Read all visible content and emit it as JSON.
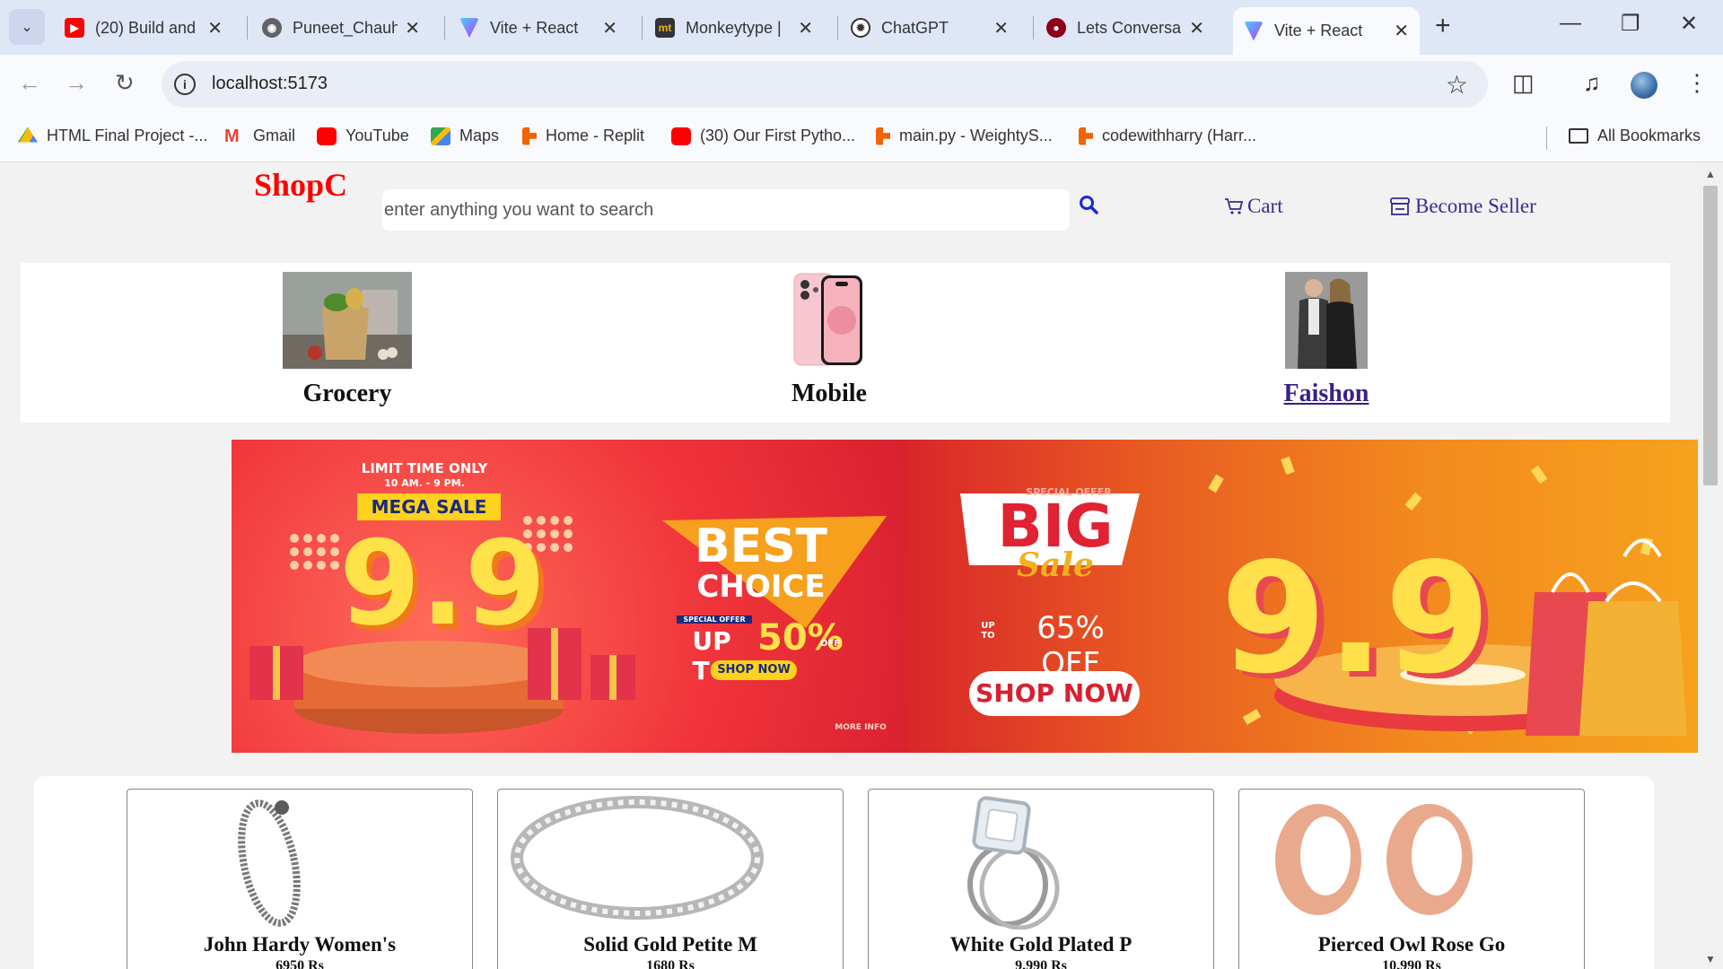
{
  "browser": {
    "tabs": [
      {
        "title": "(20) Build and",
        "icon": "youtube-icon"
      },
      {
        "title": "Puneet_Chauh",
        "icon": "globe-icon"
      },
      {
        "title": "Vite + React",
        "icon": "vite-icon"
      },
      {
        "title": "Monkeytype |",
        "icon": "monkeytype-icon"
      },
      {
        "title": "ChatGPT",
        "icon": "chatgpt-icon"
      },
      {
        "title": "Lets Conversa",
        "icon": "app-icon"
      },
      {
        "title": "Vite + React",
        "icon": "vite-icon",
        "active": true
      }
    ],
    "url": "localhost:5173",
    "bookmarks": [
      {
        "label": "HTML Final Project -...",
        "icon": "drive-icon"
      },
      {
        "label": "Gmail",
        "icon": "gmail-icon"
      },
      {
        "label": "YouTube",
        "icon": "youtube-icon"
      },
      {
        "label": "Maps",
        "icon": "maps-icon"
      },
      {
        "label": "Home - Replit",
        "icon": "replit-icon"
      },
      {
        "label": "(30) Our First Pytho...",
        "icon": "youtube-icon"
      },
      {
        "label": "main.py - WeightyS...",
        "icon": "replit-icon"
      },
      {
        "label": "codewithharry (Harr...",
        "icon": "replit-icon"
      }
    ],
    "all_bookmarks_label": "All Bookmarks"
  },
  "header": {
    "logo": "ShopC",
    "search_placeholder": "enter anything you want to search",
    "cart_label": "Cart",
    "seller_label": "Become Seller"
  },
  "categories": [
    {
      "label": "Grocery"
    },
    {
      "label": "Mobile"
    },
    {
      "label": "Faishon",
      "link": true
    }
  ],
  "banner": {
    "left": {
      "line1": "LIMIT TIME ONLY",
      "line2": "10 AM. - 9 PM.",
      "mega": "MEGA SALE",
      "number": "9.9",
      "best": "BEST",
      "choice": "CHOICE",
      "special": "SPECIAL OFFER",
      "upto": "UP TO",
      "pct": "50%",
      "off": "OFF",
      "shop": "SHOP NOW",
      "more": "MORE INFO"
    },
    "right": {
      "special": "SPECIAL OFFER",
      "big": "BIG",
      "sale": "Sale",
      "upto": "UP TO",
      "pct": "65% OFF",
      "shop": "SHOP NOW",
      "number": "9.9"
    }
  },
  "products": [
    {
      "name": "John Hardy Women's",
      "price": "6950 Rs"
    },
    {
      "name": "Solid Gold Petite M",
      "price": "1680 Rs"
    },
    {
      "name": "White Gold Plated P",
      "price": "9,990 Rs"
    },
    {
      "name": "Pierced Owl Rose Go",
      "price": "10,990 Rs"
    }
  ],
  "colors": {
    "logo": "#ff0000",
    "nav_link": "#3b2b8f",
    "search_icon": "#1c27d8"
  }
}
